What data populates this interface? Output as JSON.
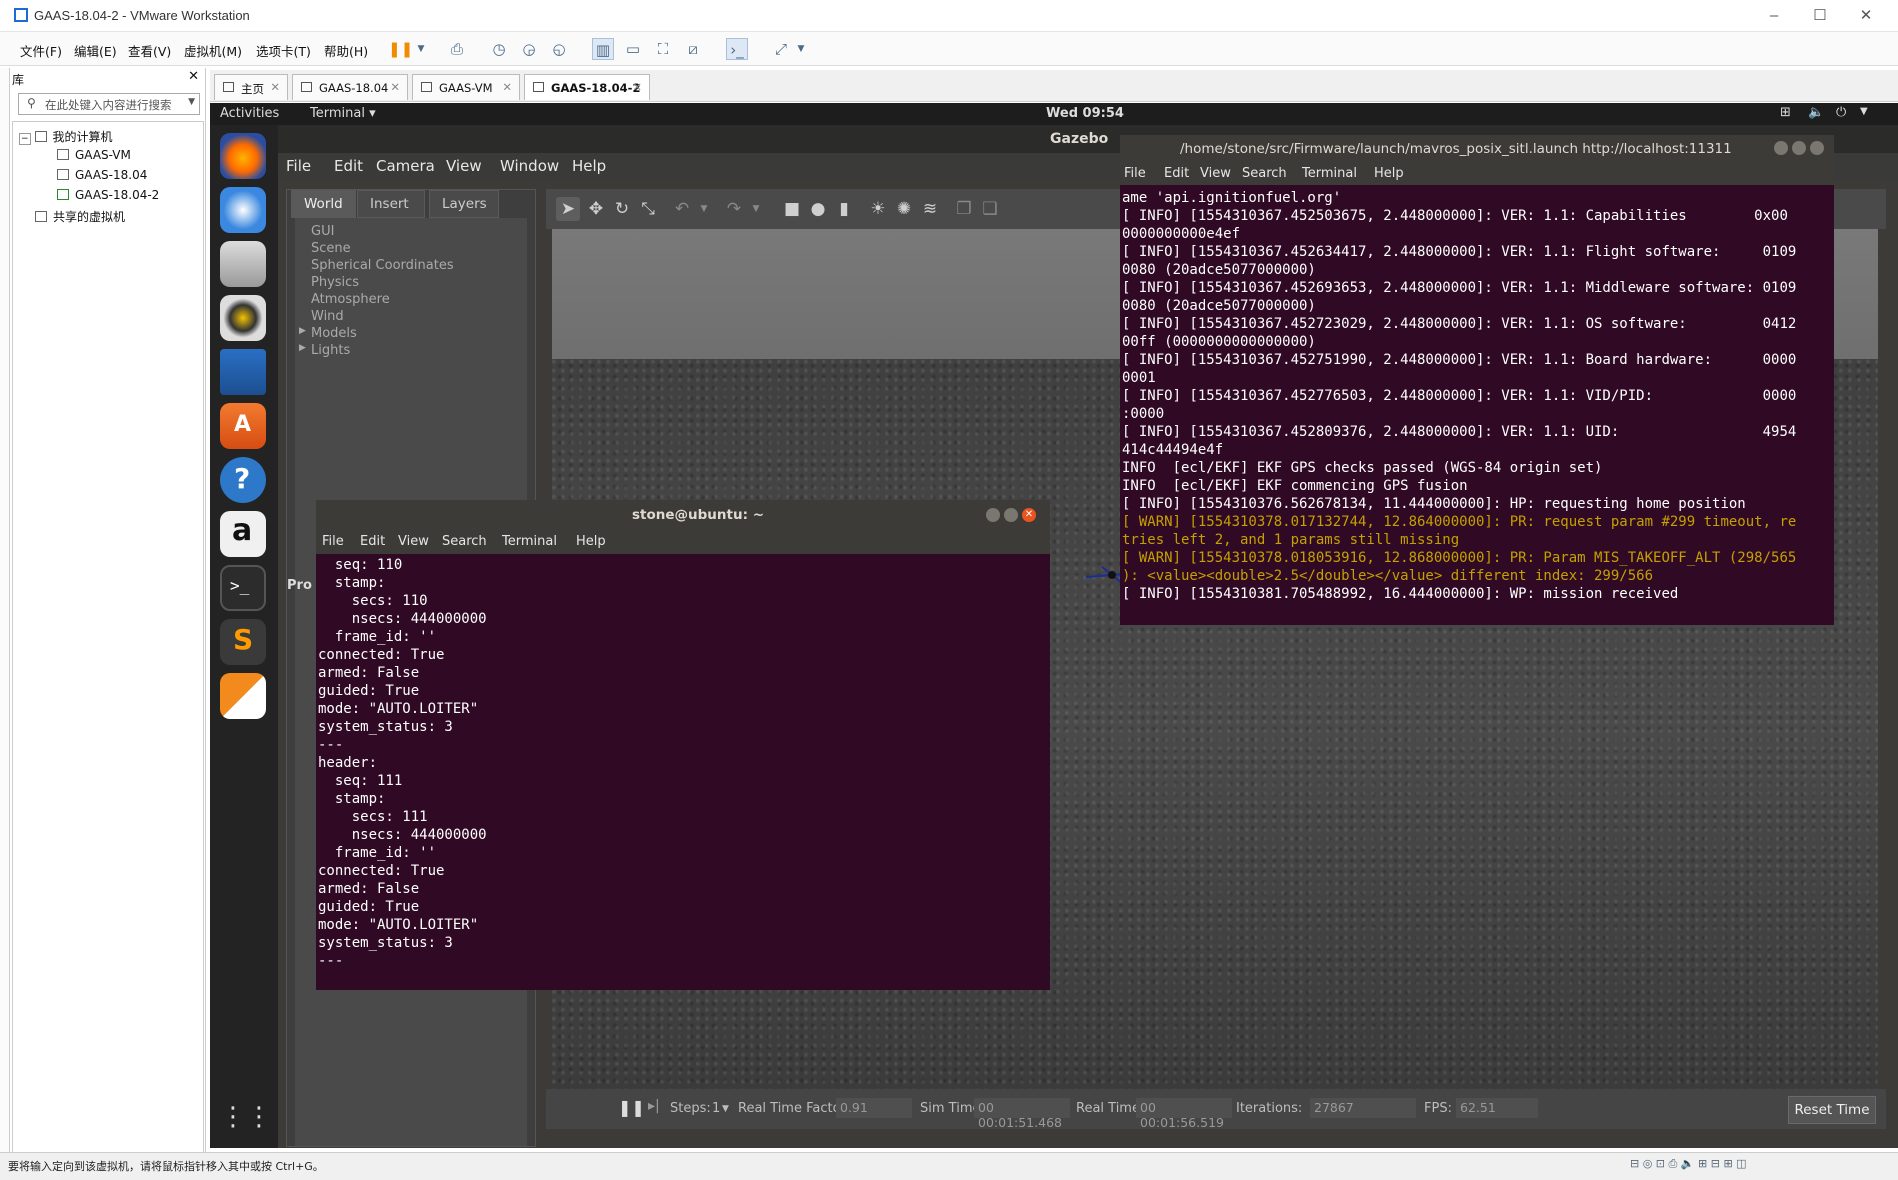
{
  "vm": {
    "title": "GAAS-18.04-2 - VMware Workstation",
    "menu": [
      "文件(F)",
      "编辑(E)",
      "查看(V)",
      "虚拟机(M)",
      "选项卡(T)",
      "帮助(H)"
    ],
    "library": {
      "header": "库",
      "search_placeholder": "在此处键入内容进行搜索",
      "tree": {
        "my_computer": "我的计算机",
        "vms": [
          "GAAS-VM",
          "GAAS-18.04",
          "GAAS-18.04-2"
        ],
        "shared": "共享的虚拟机"
      }
    },
    "tabs": [
      "主页",
      "GAAS-18.04",
      "GAAS-VM",
      "GAAS-18.04-2"
    ],
    "status_text": "要将输入定向到该虚拟机，请将鼠标指针移入其中或按 Ctrl+G。"
  },
  "ubuntu": {
    "activities": "Activities",
    "app_menu": "Terminal ▾",
    "clock": "Wed 09:54",
    "dock_icons": [
      "firefox-icon",
      "thunderbird-icon",
      "files-icon",
      "rhythmbox-icon",
      "writer-icon",
      "software-icon",
      "help-icon",
      "amazon-icon",
      "terminal-icon",
      "sublime-icon",
      "qgroundcontrol-icon",
      "apps-grid-icon"
    ]
  },
  "gazebo": {
    "title": "Gazebo",
    "menu": [
      "File",
      "Edit",
      "Camera",
      "View",
      "Window",
      "Help"
    ],
    "left_tabs": [
      "World",
      "Insert",
      "Layers"
    ],
    "world_items": [
      "GUI",
      "Scene",
      "Spherical Coordinates",
      "Physics",
      "Atmosphere",
      "Wind",
      "Models",
      "Lights"
    ],
    "props_label": "Pro",
    "status": {
      "steps_label": "Steps:",
      "steps_value": "1",
      "rtf_label": "Real Time Factor:",
      "rtf_value": "0.91",
      "sim_label": "Sim Time:",
      "sim_value": "00 00:01:51.468",
      "real_label": "Real Time:",
      "real_value": "00 00:01:56.519",
      "iter_label": "Iterations:",
      "iter_value": "27867",
      "fps_label": "FPS:",
      "fps_value": "62.51",
      "reset": "Reset Time"
    }
  },
  "terminal_right": {
    "title": "/home/stone/src/Firmware/launch/mavros_posix_sitl.launch http://localhost:11311",
    "menu": [
      "File",
      "Edit",
      "View",
      "Search",
      "Terminal",
      "Help"
    ],
    "lines": [
      {
        "t": "ame 'api.ignitionfuel.org'",
        "w": false
      },
      {
        "t": "[ INFO] [1554310367.452503675, 2.448000000]: VER: 1.1: Capabilities        0x00",
        "w": false
      },
      {
        "t": "0000000000e4ef",
        "w": false
      },
      {
        "t": "[ INFO] [1554310367.452634417, 2.448000000]: VER: 1.1: Flight software:     0109",
        "w": false
      },
      {
        "t": "0080 (20adce5077000000)",
        "w": false
      },
      {
        "t": "[ INFO] [1554310367.452693653, 2.448000000]: VER: 1.1: Middleware software: 0109",
        "w": false
      },
      {
        "t": "0080 (20adce5077000000)",
        "w": false
      },
      {
        "t": "[ INFO] [1554310367.452723029, 2.448000000]: VER: 1.1: OS software:         0412",
        "w": false
      },
      {
        "t": "00ff (0000000000000000)",
        "w": false
      },
      {
        "t": "[ INFO] [1554310367.452751990, 2.448000000]: VER: 1.1: Board hardware:      0000",
        "w": false
      },
      {
        "t": "0001",
        "w": false
      },
      {
        "t": "[ INFO] [1554310367.452776503, 2.448000000]: VER: 1.1: VID/PID:             0000",
        "w": false
      },
      {
        "t": ":0000",
        "w": false
      },
      {
        "t": "[ INFO] [1554310367.452809376, 2.448000000]: VER: 1.1: UID:                 4954",
        "w": false
      },
      {
        "t": "414c44494e4f",
        "w": false
      },
      {
        "t": "INFO  [ecl/EKF] EKF GPS checks passed (WGS-84 origin set)",
        "w": false
      },
      {
        "t": "INFO  [ecl/EKF] EKF commencing GPS fusion",
        "w": false
      },
      {
        "t": "[ INFO] [1554310376.562678134, 11.444000000]: HP: requesting home position",
        "w": false
      },
      {
        "t": "[ WARN] [1554310378.017132744, 12.864000000]: PR: request param #299 timeout, re",
        "w": true
      },
      {
        "t": "tries left 2, and 1 params still missing",
        "w": true
      },
      {
        "t": "[ WARN] [1554310378.018053916, 12.868000000]: PR: Param MIS_TAKEOFF_ALT (298/565",
        "w": true
      },
      {
        "t": "): <value><double>2.5</double></value> different index: 299/566",
        "w": true
      },
      {
        "t": "[ INFO] [1554310381.705488992, 16.444000000]: WP: mission received",
        "w": false
      }
    ]
  },
  "terminal_left": {
    "title": "stone@ubuntu: ~",
    "menu": [
      "File",
      "Edit",
      "View",
      "Search",
      "Terminal",
      "Help"
    ],
    "lines": [
      "  seq: 110",
      "  stamp:",
      "    secs: 110",
      "    nsecs: 444000000",
      "  frame_id: ''",
      "connected: True",
      "armed: False",
      "guided: True",
      "mode: \"AUTO.LOITER\"",
      "system_status: 3",
      "---",
      "header:",
      "  seq: 111",
      "  stamp:",
      "    secs: 111",
      "    nsecs: 444000000",
      "  frame_id: ''",
      "connected: True",
      "armed: False",
      "guided: True",
      "mode: \"AUTO.LOITER\"",
      "system_status: 3",
      "---"
    ]
  },
  "colors": {
    "terminal_bg": "#300a24",
    "ubuntu_orange": "#e95420",
    "warn": "#c4a000"
  }
}
